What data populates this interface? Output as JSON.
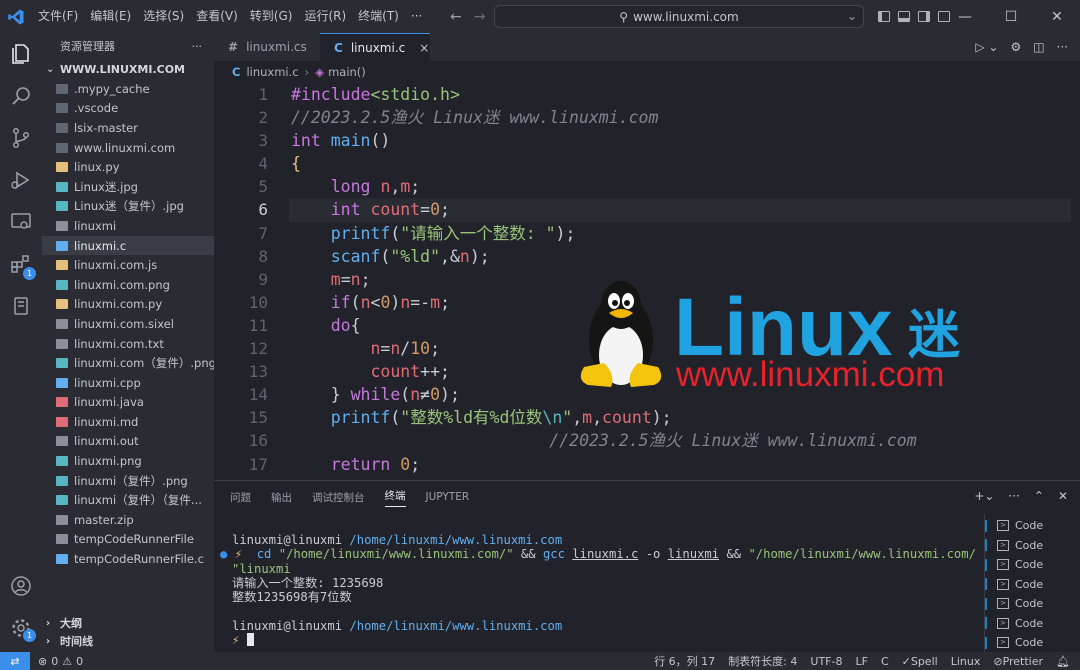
{
  "menu": [
    "文件(F)",
    "编辑(E)",
    "选择(S)",
    "查看(V)",
    "转到(G)",
    "运行(R)",
    "终端(T)",
    "···"
  ],
  "search": {
    "text": "www.linuxmi.com"
  },
  "sidebar": {
    "title": "资源管理器",
    "folder": "WWW.LINUXMI.COM",
    "files": [
      {
        "name": ".mypy_cache",
        "color": "#5f6773"
      },
      {
        "name": ".vscode",
        "color": "#5f6773"
      },
      {
        "name": "lsix-master",
        "color": "#5f6773"
      },
      {
        "name": "www.linuxmi.com",
        "color": "#5f6773"
      },
      {
        "name": "linux.py",
        "color": "#e5c07b"
      },
      {
        "name": "Linux迷.jpg",
        "color": "#56b6c2"
      },
      {
        "name": "Linux迷（复件）.jpg",
        "color": "#56b6c2"
      },
      {
        "name": "linuxmi",
        "color": "#8a8f99"
      },
      {
        "name": "linuxmi.c",
        "color": "#61afef"
      },
      {
        "name": "linuxmi.com.js",
        "color": "#e5c07b"
      },
      {
        "name": "linuxmi.com.png",
        "color": "#56b6c2"
      },
      {
        "name": "linuxmi.com.py",
        "color": "#e5c07b"
      },
      {
        "name": "linuxmi.com.sixel",
        "color": "#8a8f99"
      },
      {
        "name": "linuxmi.com.txt",
        "color": "#8a8f99"
      },
      {
        "name": "linuxmi.com（复件）.png",
        "color": "#56b6c2"
      },
      {
        "name": "linuxmi.cpp",
        "color": "#61afef"
      },
      {
        "name": "linuxmi.java",
        "color": "#e06c75"
      },
      {
        "name": "linuxmi.md",
        "color": "#e06c75"
      },
      {
        "name": "linuxmi.out",
        "color": "#8a8f99"
      },
      {
        "name": "linuxmi.png",
        "color": "#56b6c2"
      },
      {
        "name": "linuxmi（复件）.png",
        "color": "#56b6c2"
      },
      {
        "name": "linuxmi（复件）（复件...",
        "color": "#56b6c2"
      },
      {
        "name": "master.zip",
        "color": "#8a8f99"
      },
      {
        "name": "tempCodeRunnerFile",
        "color": "#8a8f99"
      },
      {
        "name": "tempCodeRunnerFile.c",
        "color": "#61afef"
      }
    ],
    "outline": "大纲",
    "timeline": "时间线"
  },
  "tabs": [
    {
      "label": "linuxmi.cs",
      "icon": "#"
    },
    {
      "label": "linuxmi.c",
      "icon": "C",
      "close": "×"
    }
  ],
  "breadcrumb": {
    "file": "linuxmi.c",
    "symbol": "main()"
  },
  "editor": {
    "line_numbers": [
      "1",
      "2",
      "3",
      "4",
      "5",
      "6",
      "7",
      "8",
      "9",
      "10",
      "11",
      "12",
      "13",
      "14",
      "15",
      "16",
      "17"
    ],
    "current_line": "6"
  },
  "logo": {
    "brand": "Linux",
    "brand_cn": "迷",
    "url": "www.linuxmi.com"
  },
  "panel": {
    "tabs": [
      "问题",
      "输出",
      "调试控制台",
      "终端",
      "JUPYTER"
    ],
    "active_tab": "终端",
    "terminal": {
      "user1": "linuxmi@linuxmi",
      "path1": "/home/linuxmi/www.linuxmi.com",
      "cmd_prompt": "⚡",
      "cmd_cd": "cd",
      "cmd_path": "\"/home/linuxmi/www.linuxmi.com/\"",
      "cmd_and1": "&&",
      "cmd_gcc": "gcc",
      "cmd_src": "linuxmi.c",
      "cmd_o": "-o",
      "cmd_out": "linuxmi",
      "cmd_and2": "&&",
      "cmd_run1": "\"/home/linuxmi/www.linuxmi.com/",
      "cmd_run2": "\"linuxmi",
      "out1": "请输入一个整数: 1235698",
      "out2": "整数1235698有7位数",
      "user2": "linuxmi@linuxmi",
      "path2": "/home/linuxmi/www.linuxmi.com",
      "prompt2": "⚡"
    },
    "terminal_list": [
      "Code",
      "Code",
      "Code",
      "Code",
      "Code",
      "Code",
      "Code"
    ]
  },
  "status": {
    "errors": "0",
    "warnings": "0",
    "position": "行 6，列 17",
    "tab_size": "制表符长度: 4",
    "encoding": "UTF-8",
    "eol": "LF",
    "language": "C",
    "spell": "Spell",
    "os": "Linux",
    "prettier": "Prettier"
  }
}
